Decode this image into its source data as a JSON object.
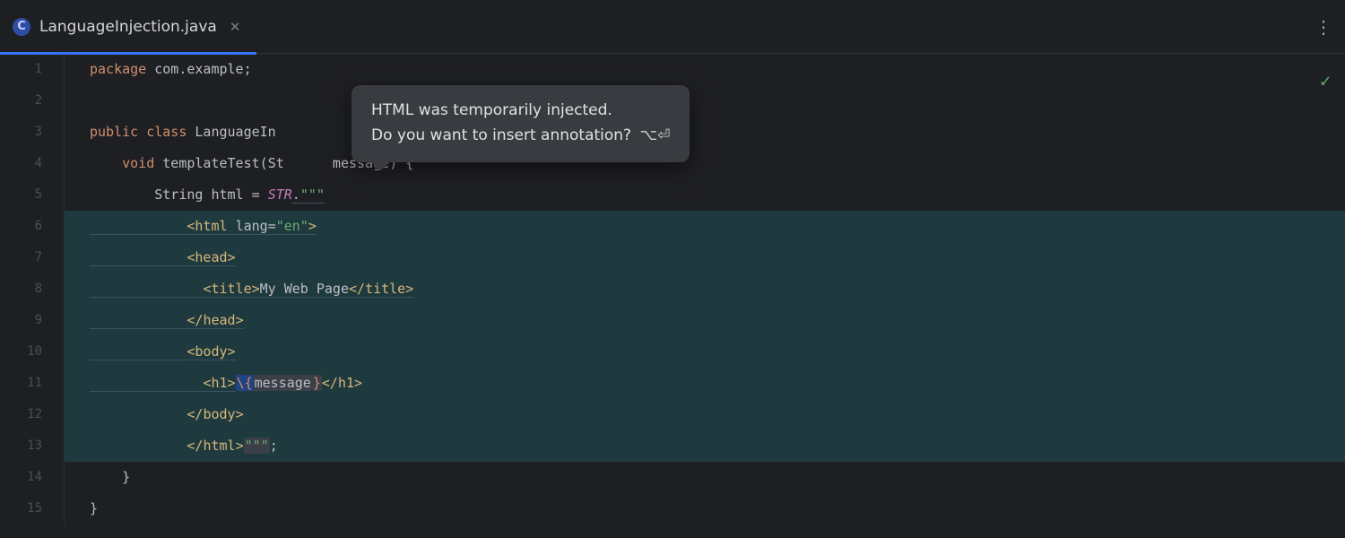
{
  "tab": {
    "file_icon_letter": "C",
    "filename": "LanguageInjection.java"
  },
  "tooltip": {
    "line1": "HTML was temporarily injected.",
    "line2": "Do you want to insert annotation?",
    "shortcut": "⌥⏎"
  },
  "gutter": {
    "lines": [
      "1",
      "2",
      "3",
      "4",
      "5",
      "6",
      "7",
      "8",
      "9",
      "10",
      "11",
      "12",
      "13",
      "14",
      "15"
    ]
  },
  "code": {
    "l1": {
      "kw_package": "package",
      "pkg": "com.example",
      "semi": ";"
    },
    "l3": {
      "kw_public": "public",
      "kw_class": "class",
      "name_prefix": "LanguageIn"
    },
    "l4": {
      "kw_void": "void",
      "method": "templateTest",
      "paren_open": "(",
      "param_type_prefix": "St",
      "param_rest": "      message)",
      "brace": " {"
    },
    "l5": {
      "type_String": "String",
      "var": "html",
      "eq": " = ",
      "str": "STR",
      "dot": ".",
      "quotes": "\"\"\""
    },
    "l6": {
      "open": "<",
      "tag": "html",
      "sp": " ",
      "attr": "lang",
      "eq": "=",
      "val": "\"en\"",
      "close": ">"
    },
    "l7": {
      "open": "<",
      "tag": "head",
      "close": ">"
    },
    "l8": {
      "open": "<",
      "tag": "title",
      "close1": ">",
      "text": "My Web Page",
      "open2": "</",
      "tag2": "title",
      "close2": ">"
    },
    "l9": {
      "open": "</",
      "tag": "head",
      "close": ">"
    },
    "l10": {
      "open": "<",
      "tag": "body",
      "close": ">"
    },
    "l11": {
      "open": "<",
      "tag": "h1",
      "close1": ">",
      "esc": "\\{",
      "expr": "message",
      "rbrace": "}",
      "open2": "</",
      "tag2": "h1",
      "close2": ">"
    },
    "l12": {
      "open": "</",
      "tag": "body",
      "close": ">"
    },
    "l13": {
      "open": "</",
      "tag": "html",
      "close": ">",
      "quotes": "\"\"\"",
      "semi": ";"
    },
    "l14": {
      "brace": "}"
    },
    "l15": {
      "brace": "}"
    }
  },
  "status": {
    "ok": "✓"
  }
}
